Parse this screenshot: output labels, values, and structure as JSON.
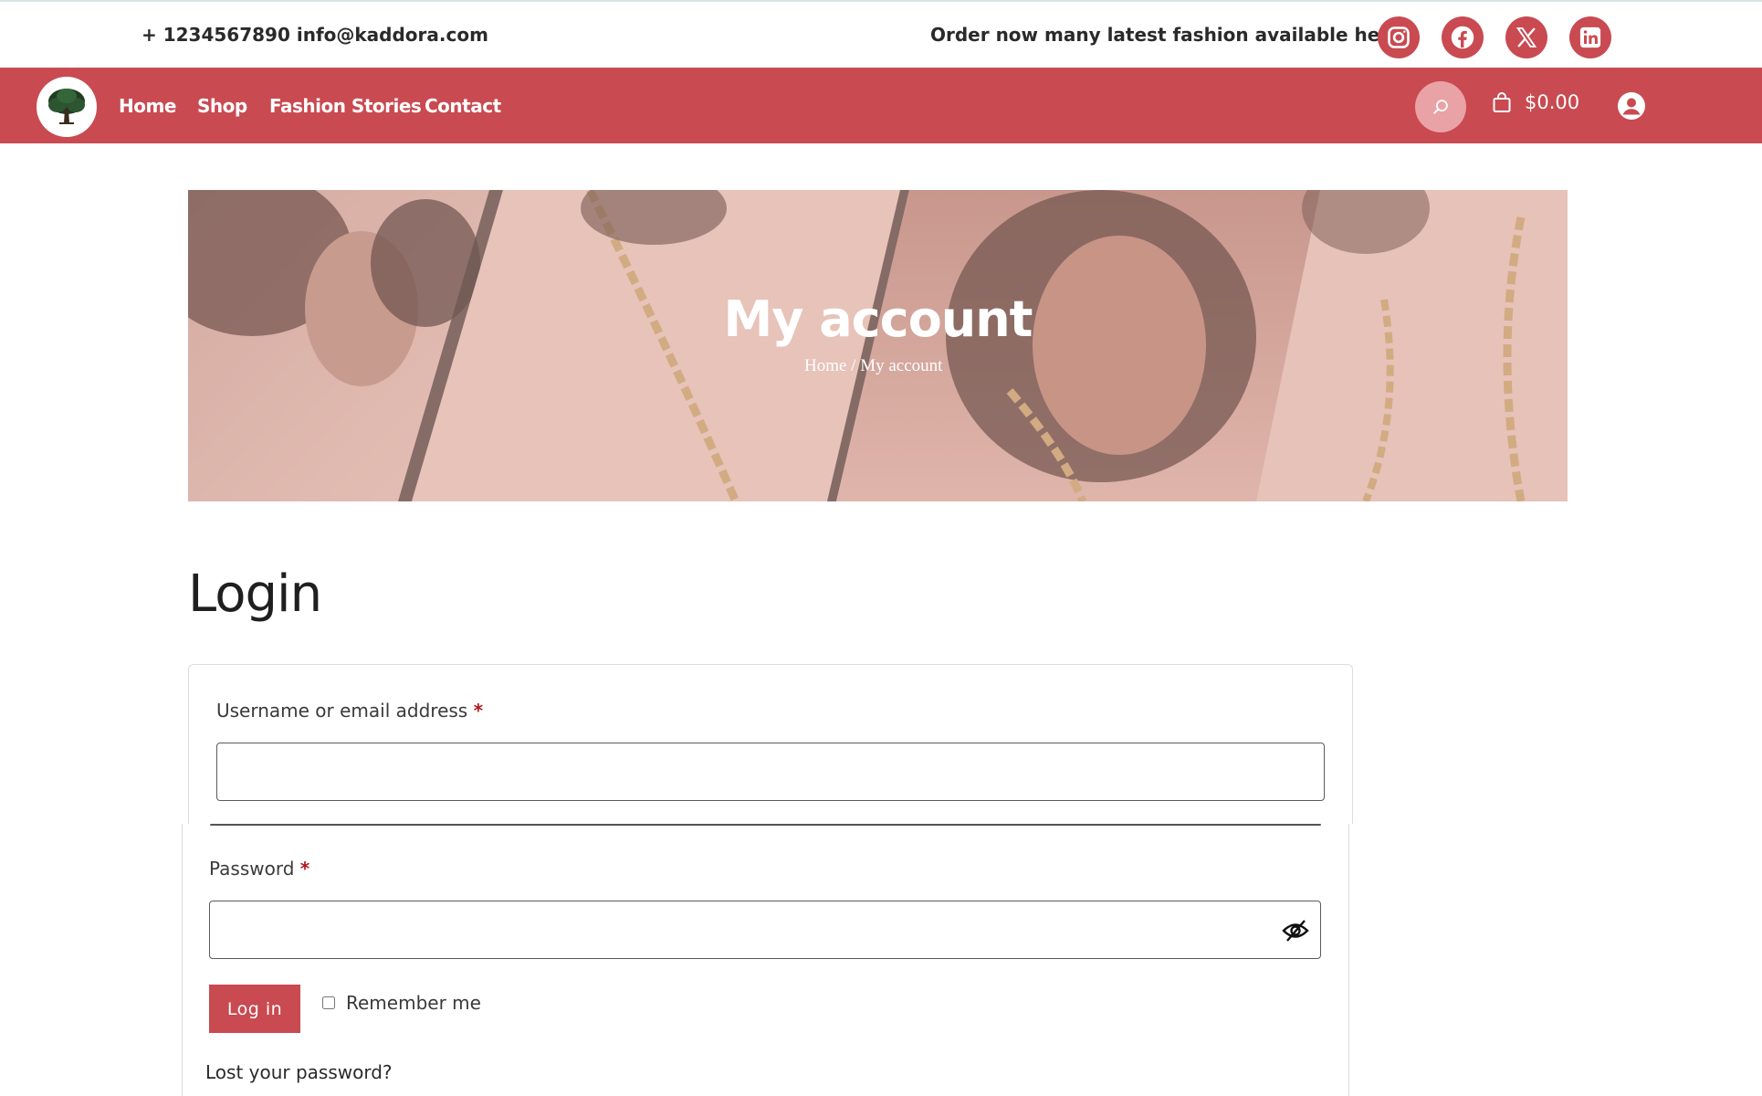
{
  "topbar": {
    "contact": "+ 1234567890 info@kaddora.com",
    "promo": "Order now many latest fashion available here",
    "social": [
      {
        "icon": "instagram-icon"
      },
      {
        "icon": "facebook-icon"
      },
      {
        "icon": "x-icon"
      },
      {
        "icon": "linkedin-icon"
      }
    ]
  },
  "nav": {
    "logo_icon": "tree-logo-icon",
    "links": [
      "Home",
      "Shop",
      "Fashion Stories",
      "Contact"
    ],
    "cart_total": "$0.00"
  },
  "hero": {
    "title": "My account",
    "breadcrumb": "Home / My account"
  },
  "login": {
    "title": "Login",
    "username_label": "Username or email address",
    "username_value": "",
    "password_label": "Password",
    "password_value": "",
    "required_mark": "*",
    "submit_label": "Log in",
    "remember_label": "Remember me",
    "remember_checked": false,
    "lost_password": "Lost your password?"
  },
  "colors": {
    "accent": "#c94a51",
    "accent_light": "#e9a2a5",
    "required": "#b0161e"
  }
}
